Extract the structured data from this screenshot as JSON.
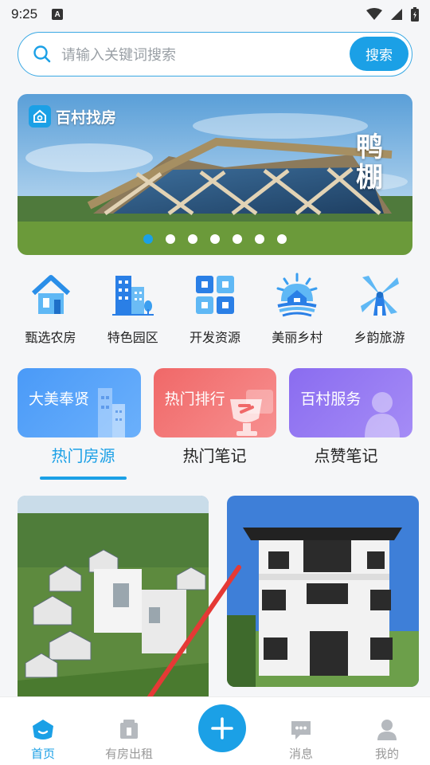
{
  "status_bar": {
    "time": "9:25",
    "badge": "A"
  },
  "search": {
    "placeholder": "请输入关键词搜索",
    "button_label": "搜索"
  },
  "banner": {
    "brand": "百村找房",
    "calligraphy": "鸭棚",
    "slide_count": 7,
    "active_slide": 1
  },
  "categories": [
    {
      "label": "甄选农房",
      "icon": "house-icon"
    },
    {
      "label": "特色园区",
      "icon": "buildings-icon"
    },
    {
      "label": "开发资源",
      "icon": "grid-icon"
    },
    {
      "label": "美丽乡村",
      "icon": "village-sun-icon"
    },
    {
      "label": "乡韵旅游",
      "icon": "windmill-icon"
    }
  ],
  "cards": [
    {
      "label": "大美奉贤",
      "color": "#3e8ef7"
    },
    {
      "label": "热门排行",
      "color": "#f06b6b"
    },
    {
      "label": "百村服务",
      "color": "#8f6ef2"
    }
  ],
  "tabs": [
    {
      "label": "热门房源",
      "active": true
    },
    {
      "label": "热门笔记",
      "active": false
    },
    {
      "label": "点赞笔记",
      "active": false
    }
  ],
  "bottom_nav": [
    {
      "label": "首页",
      "icon": "home-icon",
      "active": true
    },
    {
      "label": "有房出租",
      "icon": "rent-icon",
      "active": false
    },
    {
      "label": "消息",
      "icon": "message-icon",
      "active": false
    },
    {
      "label": "我的",
      "icon": "profile-icon",
      "active": false
    }
  ],
  "colors": {
    "accent": "#1ba0e6",
    "arrow": "#e53935"
  }
}
